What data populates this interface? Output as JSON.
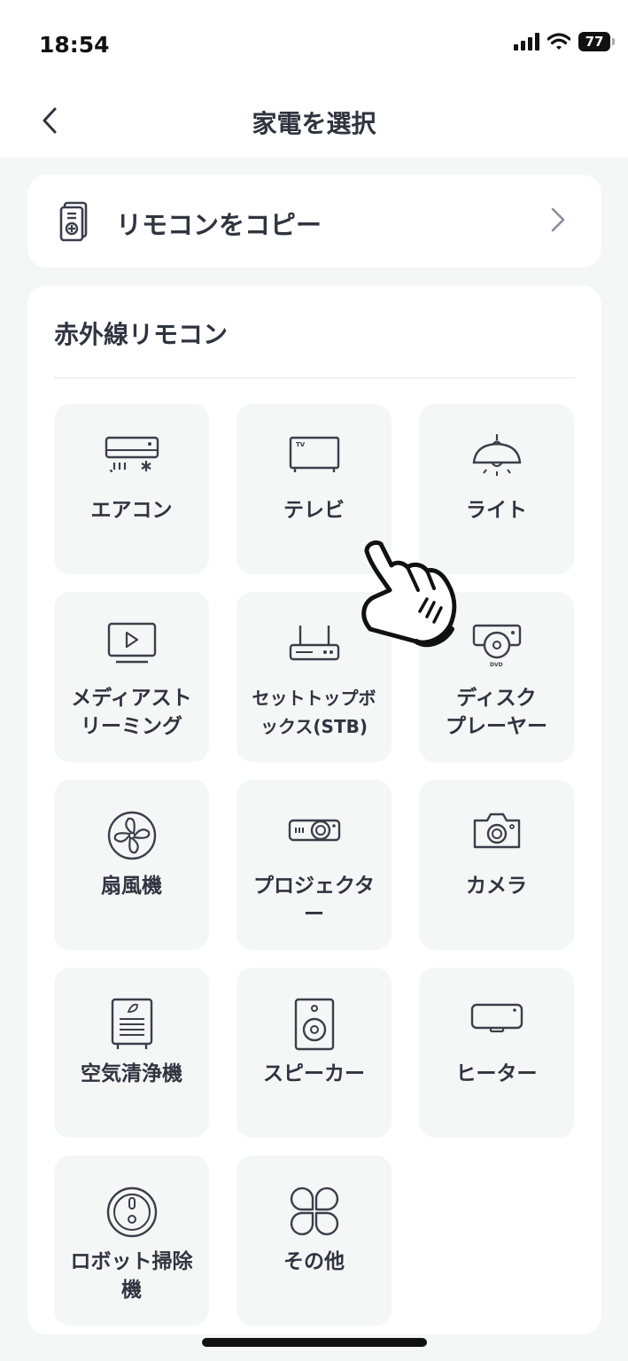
{
  "status_bar": {
    "time": "18:54",
    "battery": "77"
  },
  "nav": {
    "title": "家電を選択",
    "back_icon": "chevron-left-icon"
  },
  "copy_remote": {
    "label": "リモコンをコピー",
    "icon": "remote-copy-icon",
    "chevron": "chevron-right-icon"
  },
  "section": {
    "title": "赤外線リモコン"
  },
  "devices": [
    {
      "label": "エアコン",
      "icon": "air-conditioner-icon"
    },
    {
      "label": "テレビ",
      "icon": "tv-icon"
    },
    {
      "label": "ライト",
      "icon": "ceiling-light-icon"
    },
    {
      "label": "メディアスト\nリーミング",
      "icon": "media-streaming-icon"
    },
    {
      "label": "セットトップボ\nックス(STB)",
      "icon": "set-top-box-icon"
    },
    {
      "label": "ディスク\nプレーヤー",
      "icon": "disc-player-icon"
    },
    {
      "label": "扇風機",
      "icon": "fan-icon"
    },
    {
      "label": "プロジェクタ\nー",
      "icon": "projector-icon"
    },
    {
      "label": "カメラ",
      "icon": "camera-icon"
    },
    {
      "label": "空気清浄機",
      "icon": "air-purifier-icon"
    },
    {
      "label": "スピーカー",
      "icon": "speaker-icon"
    },
    {
      "label": "ヒーター",
      "icon": "heater-icon"
    },
    {
      "label": "ロボット掃除\n機",
      "icon": "robot-vacuum-icon"
    },
    {
      "label": "その他",
      "icon": "other-icon"
    }
  ],
  "colors": {
    "background": "#f5f6f6",
    "card": "#ffffff",
    "tile": "#f5f6f6",
    "text": "#2f3440",
    "icon_stroke": "#3a3f4a"
  }
}
